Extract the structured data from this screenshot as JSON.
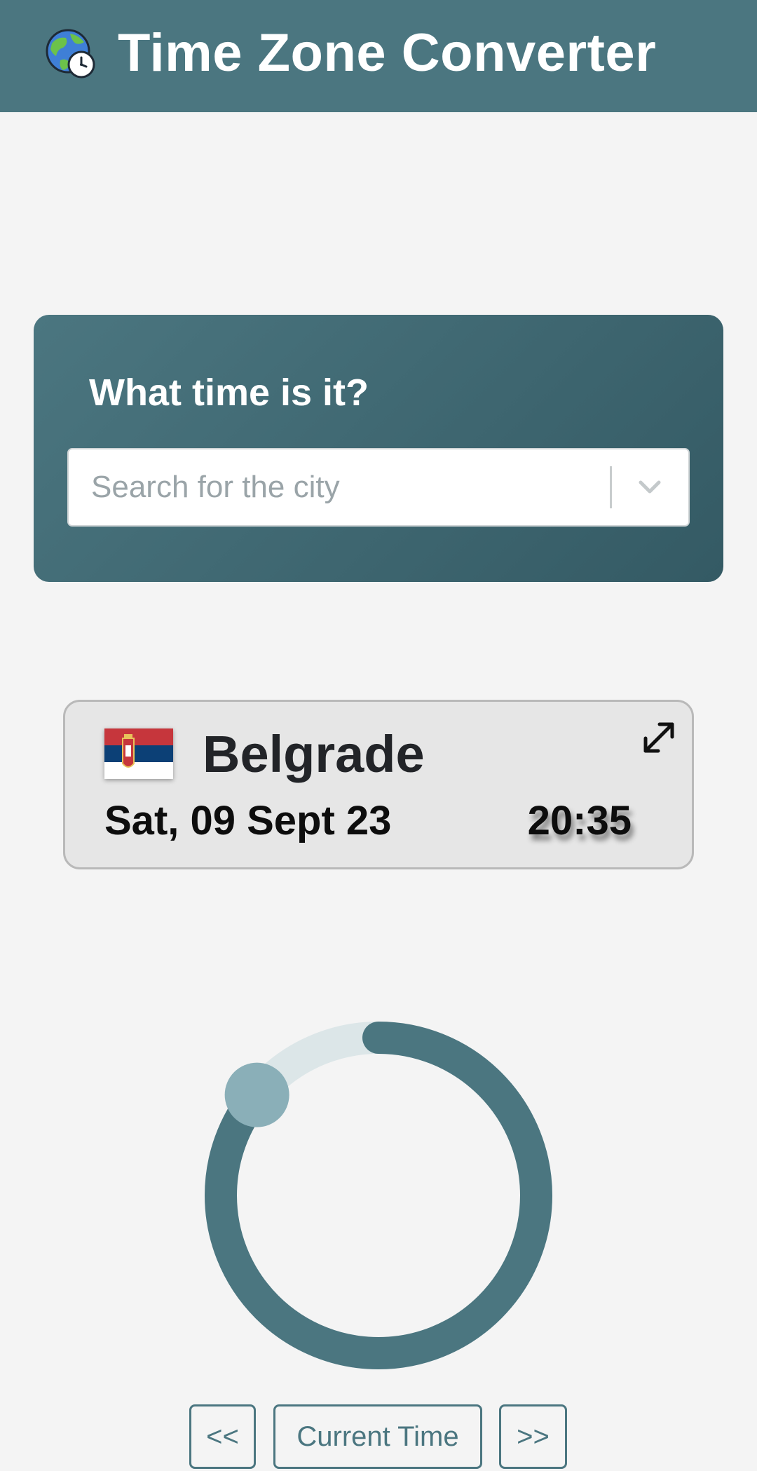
{
  "header": {
    "title": "Time Zone Converter",
    "logo_icon": "globe-clock-icon"
  },
  "search": {
    "question": "What time is it?",
    "placeholder": "Search for the city",
    "value": "",
    "dropdown_icon": "chevron-down-icon"
  },
  "city_card": {
    "city": "Belgrade",
    "country_flag": "serbia-flag-icon",
    "date": "Sat, 09 Sept 23",
    "time": "20:35",
    "expand_icon": "expand-icon"
  },
  "dial": {
    "progress_fraction": 0.86,
    "track_color": "#dce6e8",
    "progress_color": "#4b7680",
    "handle_color": "#8aafb8"
  },
  "controls": {
    "prev_label": "<<",
    "now_label": "Current Time",
    "next_label": ">>"
  },
  "colors": {
    "accent": "#4b7680",
    "background": "#f4f4f4"
  }
}
